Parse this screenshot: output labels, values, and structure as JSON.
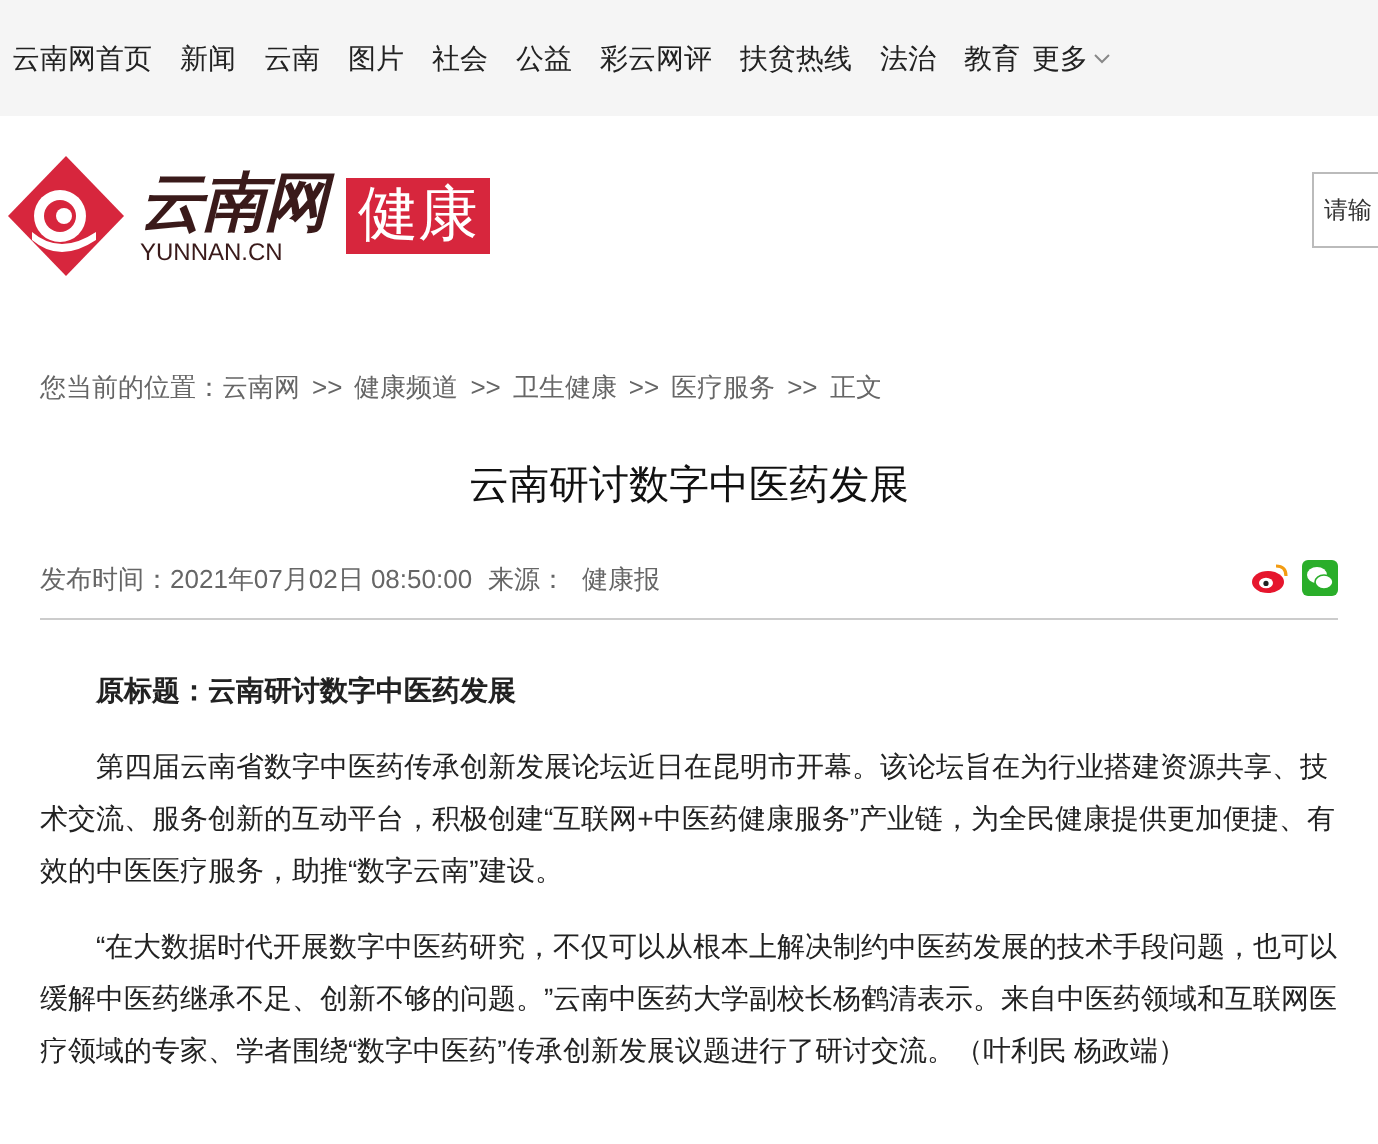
{
  "nav": {
    "items": [
      "云南网首页",
      "新闻",
      "云南",
      "图片",
      "社会",
      "公益",
      "彩云网评",
      "扶贫热线",
      "法治",
      "教育"
    ],
    "more": "更多"
  },
  "logo": {
    "name": "云南网",
    "domain": "YUNNAN.CN",
    "channel": "健康"
  },
  "search": {
    "placeholder": "请输"
  },
  "breadcrumb": {
    "prefix": "您当前的位置：",
    "items": [
      "云南网",
      "健康频道",
      "卫生健康",
      "医疗服务",
      "正文"
    ],
    "separator": ">>"
  },
  "article": {
    "title": "云南研讨数字中医药发展",
    "published": "发布时间：2021年07月02日 08:50:00",
    "source_label": "来源：",
    "source": "健康报",
    "paragraphs": [
      {
        "kind": "subtitle",
        "text": "原标题：云南研讨数字中医药发展"
      },
      {
        "kind": "body",
        "text": "第四届云南省数字中医药传承创新发展论坛近日在昆明市开幕。该论坛旨在为行业搭建资源共享、技术交流、服务创新的互动平台，积极创建“互联网+中医药健康服务”产业链，为全民健康提供更加便捷、有效的中医医疗服务，助推“数字云南”建设。"
      },
      {
        "kind": "body",
        "text": "“在大数据时代开展数字中医药研究，不仅可以从根本上解决制约中医药发展的技术手段问题，也可以缓解中医药继承不足、创新不够的问题。”云南中医药大学副校长杨鹤清表示。来自中医药领域和互联网医疗领域的专家、学者围绕“数字中医药”传承创新发展议题进行了研讨交流。（叶利民 杨政端）"
      }
    ]
  }
}
